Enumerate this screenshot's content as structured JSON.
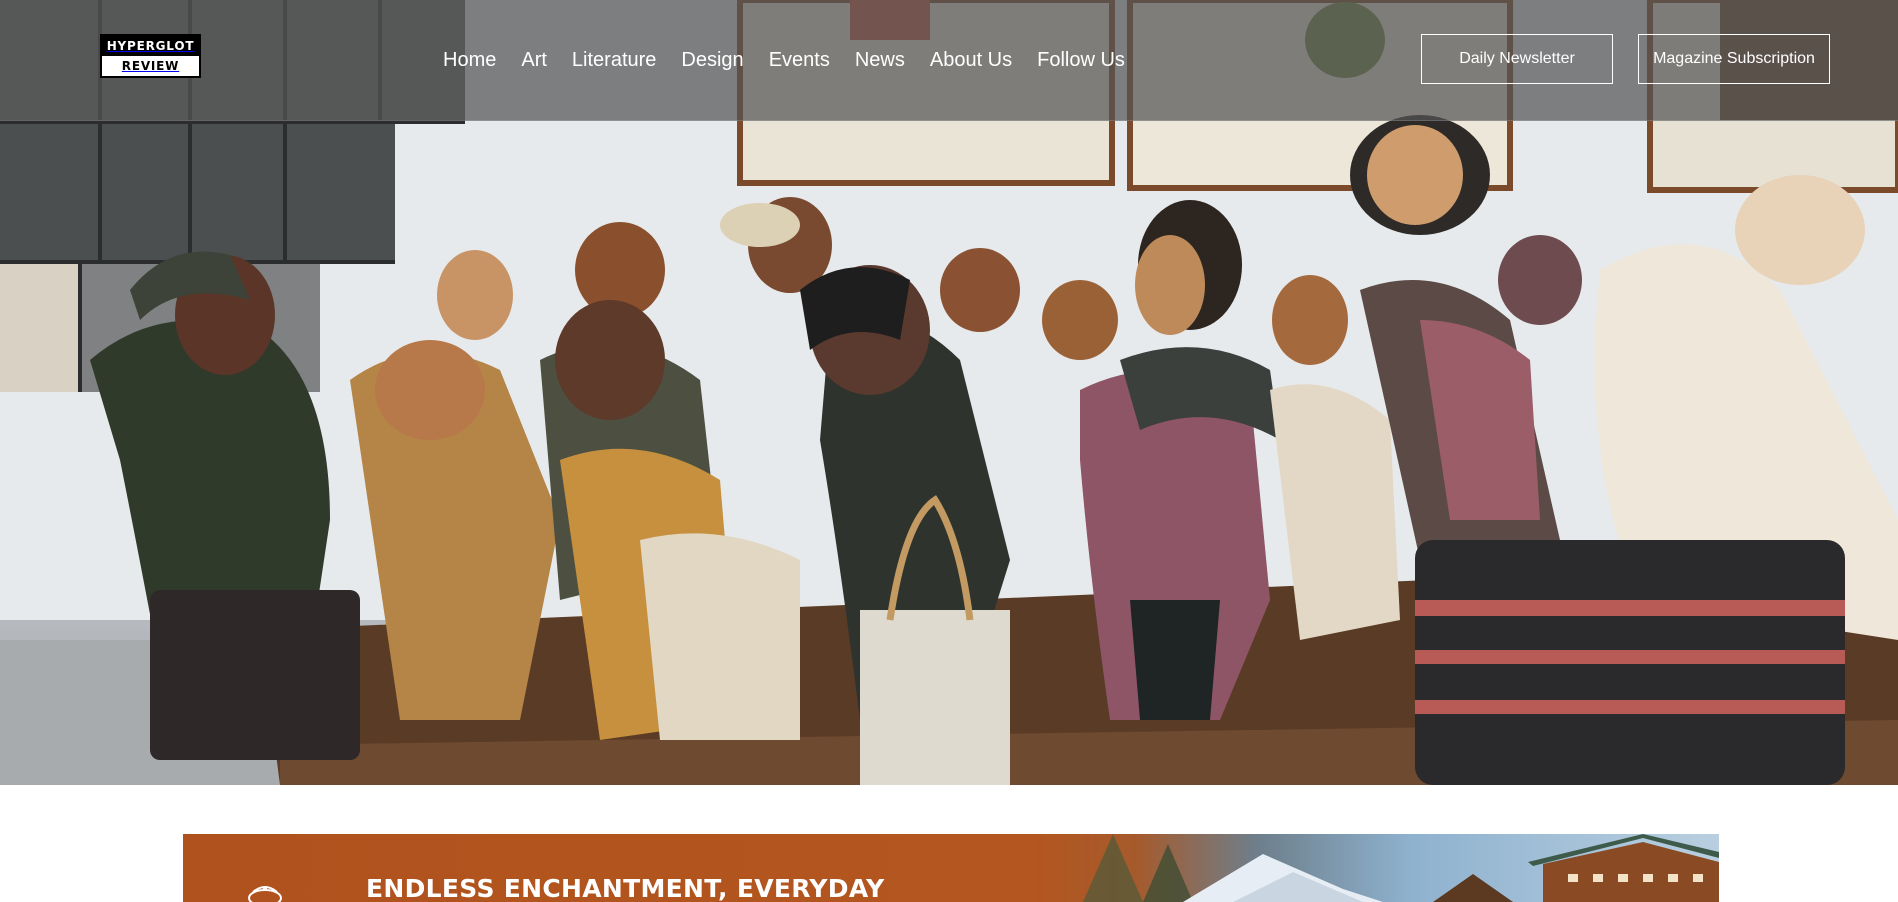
{
  "site": {
    "logo_line1": "HYPERGLOT",
    "logo_line2": "REVIEW"
  },
  "nav": {
    "items": [
      "Home",
      "Art",
      "Literature",
      "Design",
      "Events",
      "News",
      "About Us",
      "Follow Us"
    ]
  },
  "buttons": {
    "newsletter": "Daily Newsletter",
    "subscription": "Magazine Subscription"
  },
  "banner": {
    "headline": "ENDLESS ENCHANTMENT, EVERYDAY"
  },
  "colors": {
    "header_overlay": "#555555",
    "banner_orange": "#b0521d",
    "link": "#ffffff"
  }
}
